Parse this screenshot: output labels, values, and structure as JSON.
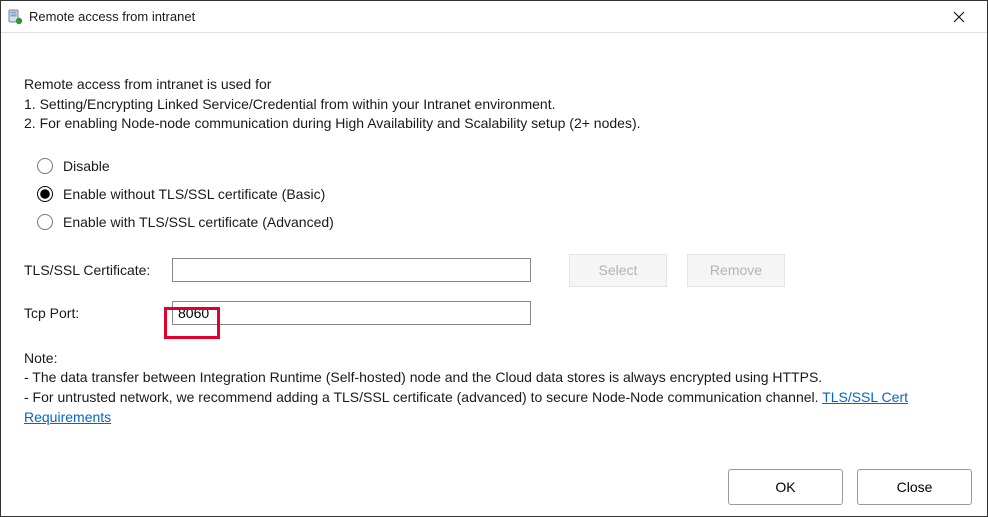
{
  "window": {
    "title": "Remote access from intranet"
  },
  "intro": {
    "heading": "Remote access from intranet is used for",
    "line1": "1. Setting/Encrypting Linked Service/Credential from within your Intranet environment.",
    "line2": "2. For enabling Node-node communication during High Availability and Scalability setup (2+ nodes)."
  },
  "options": {
    "disable": "Disable",
    "enable_basic": "Enable without TLS/SSL certificate (Basic)",
    "enable_advanced": "Enable with TLS/SSL certificate (Advanced)"
  },
  "form": {
    "cert_label": "TLS/SSL Certificate:",
    "cert_value": "",
    "select_btn": "Select",
    "remove_btn": "Remove",
    "port_label": "Tcp Port:",
    "port_value": "8060"
  },
  "note": {
    "heading": "Note:",
    "line1": " - The data transfer between Integration Runtime (Self-hosted) node and the Cloud data stores is always encrypted using HTTPS.",
    "line2_prefix": " - For untrusted network, we recommend adding a TLS/SSL certificate (advanced) to secure Node-Node communication channel. ",
    "link_text": "TLS/SSL Cert Requirements"
  },
  "buttons": {
    "ok": "OK",
    "close": "Close"
  }
}
